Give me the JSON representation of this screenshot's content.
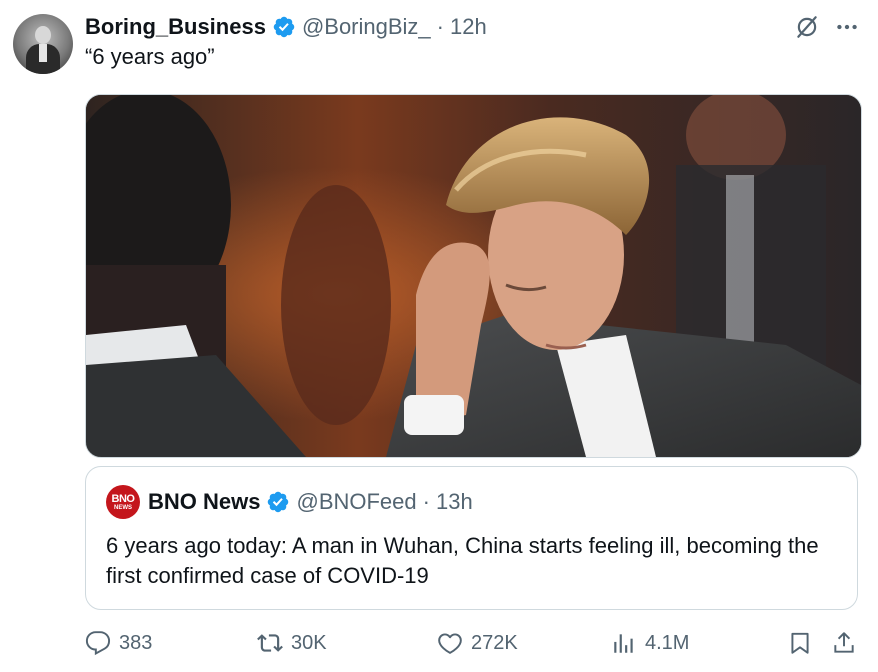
{
  "tweet": {
    "display_name": "Boring_Business",
    "handle": "@BoringBiz_",
    "separator": "·",
    "time": "12h",
    "text": "“6 years ago”"
  },
  "quoted": {
    "avatar_line1": "BNO",
    "avatar_line2": "NEWS",
    "display_name": "BNO News",
    "handle": "@BNOFeed",
    "separator": "·",
    "time": "13h",
    "text": "6 years ago today: A man in Wuhan, China starts feeling ill, becoming the first confirmed case of COVID-19"
  },
  "actions": {
    "replies": "383",
    "reposts": "30K",
    "likes": "272K",
    "views": "4.1M"
  },
  "icons": {
    "verified": "verified-badge-icon",
    "grok": "grok-icon",
    "more": "more-dots-icon",
    "reply": "reply-icon",
    "repost": "repost-icon",
    "like": "heart-icon",
    "views": "views-chart-icon",
    "bookmark": "bookmark-icon",
    "share": "share-icon"
  },
  "colors": {
    "verified_blue": "#1d9bf0",
    "secondary_text": "#536471",
    "border": "#cfd9de",
    "bno_red": "#c4161c"
  }
}
